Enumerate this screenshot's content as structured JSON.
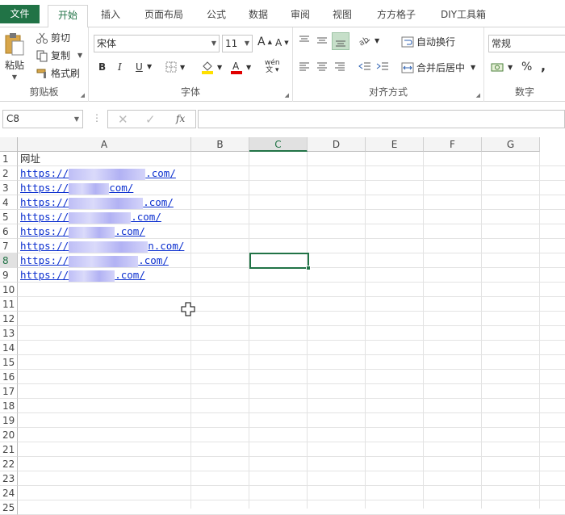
{
  "tabs": [
    "文件",
    "开始",
    "插入",
    "页面布局",
    "公式",
    "数据",
    "审阅",
    "视图",
    "方方格子",
    "DIY工具箱"
  ],
  "ribbon": {
    "clipboard": {
      "paste": "粘贴",
      "cut": "剪切",
      "copy": "复制",
      "format_painter": "格式刷",
      "label": "剪贴板"
    },
    "font": {
      "family": "宋体",
      "size": "11",
      "bold": "B",
      "italic": "I",
      "underline": "U",
      "phonetic": "wén",
      "label": "字体"
    },
    "alignment": {
      "wrap": "自动换行",
      "merge": "合并后居中",
      "label": "对齐方式"
    },
    "number": {
      "format": "常规",
      "percent": "%",
      "comma": ",",
      "label": "数字"
    }
  },
  "formula_bar": {
    "name_box": "C8",
    "fx": "fx",
    "value": ""
  },
  "columns": [
    "A",
    "B",
    "C",
    "D",
    "E",
    "F",
    "G"
  ],
  "selected_column": "C",
  "selected_row": "8",
  "rows": [
    "1",
    "2",
    "3",
    "4",
    "5",
    "6",
    "7",
    "8",
    "9",
    "10",
    "11",
    "12",
    "13",
    "14",
    "15",
    "16",
    "17",
    "18",
    "19",
    "20",
    "21",
    "22",
    "23",
    "24",
    "25"
  ],
  "cells": [
    {
      "row": "1",
      "prefix": "网址",
      "suffix": ""
    },
    {
      "row": "2",
      "prefix": "https://",
      "suffix": ".com/"
    },
    {
      "row": "3",
      "prefix": "https://",
      "suffix": "com/"
    },
    {
      "row": "4",
      "prefix": "https://",
      "suffix": ".com/"
    },
    {
      "row": "5",
      "prefix": "https://",
      "suffix": ".com/"
    },
    {
      "row": "6",
      "prefix": "https://",
      "suffix": ".com/"
    },
    {
      "row": "7",
      "prefix": "https://",
      "suffix": "n.com/"
    },
    {
      "row": "8",
      "prefix": "https://",
      "suffix": ".com/"
    },
    {
      "row": "9",
      "prefix": "https://",
      "suffix": ".com/"
    }
  ],
  "colors": {
    "accent": "#217346",
    "link": "#0b2fcf"
  }
}
